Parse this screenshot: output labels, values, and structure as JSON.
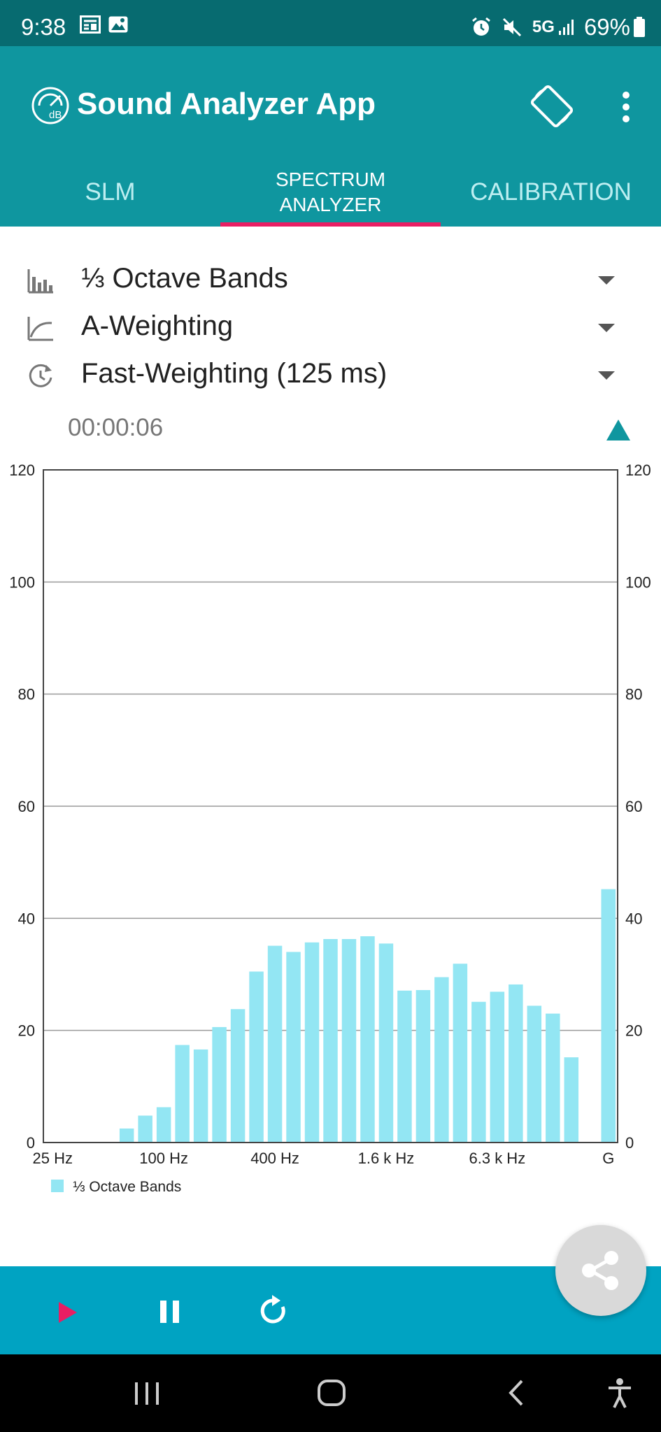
{
  "status_bar": {
    "time": "9:38",
    "network": "5G",
    "battery": "69%",
    "icons": [
      "news-icon",
      "image-icon",
      "alarm-icon",
      "mute-icon",
      "signal-icon",
      "battery-icon"
    ]
  },
  "app_bar": {
    "title": "Sound Analyzer App",
    "logo_text": "dB",
    "icons": [
      "db-logo-icon",
      "screen-rotate-icon",
      "more-vert-icon"
    ],
    "background": "#0f969f"
  },
  "tabs": [
    {
      "label": "SLM",
      "active": false
    },
    {
      "label": "SPECTRUM\nANALYZER",
      "active": true
    },
    {
      "label": "CALIBRATION",
      "active": false
    }
  ],
  "accent_color": "#e91e63",
  "settings": {
    "bands": {
      "label": "⅓ Octave Bands",
      "icon": "bar-chart-icon"
    },
    "weighting": {
      "label": "A-Weighting",
      "icon": "curve-icon"
    },
    "time_weighting": {
      "label": "Fast-Weighting (125 ms)",
      "icon": "timer-icon"
    }
  },
  "timer": "00:00:06",
  "chart_data": {
    "type": "bar",
    "ylim": [
      0,
      120
    ],
    "yticks": [
      0,
      20,
      40,
      60,
      80,
      100,
      120
    ],
    "grid": true,
    "bar_color": "#93e6f3",
    "x_tick_labels": [
      "25 Hz",
      "100 Hz",
      "400 Hz",
      "1.6 k Hz",
      "6.3 k Hz",
      "G"
    ],
    "legend": "⅓ Octave Bands",
    "legend_position": "bottom-left",
    "series": [
      {
        "name": "⅓ Octave Bands",
        "values": [
          0,
          0,
          0,
          0,
          2.5,
          4.8,
          6.3,
          17.4,
          16.6,
          20.6,
          23.8,
          30.5,
          35.1,
          34.0,
          35.7,
          36.3,
          36.3,
          36.8,
          35.5,
          27.1,
          27.2,
          29.5,
          31.9,
          25.1,
          26.9,
          28.2,
          24.4,
          23.0,
          15.2,
          0,
          45.2
        ]
      }
    ]
  },
  "controls": {
    "icons": [
      "play-icon",
      "pause-icon",
      "reset-icon",
      "share-icon"
    ],
    "background": "#00a3c2"
  },
  "nav_bar": {
    "icons": [
      "recents-icon",
      "home-icon",
      "back-icon",
      "accessibility-icon"
    ]
  }
}
